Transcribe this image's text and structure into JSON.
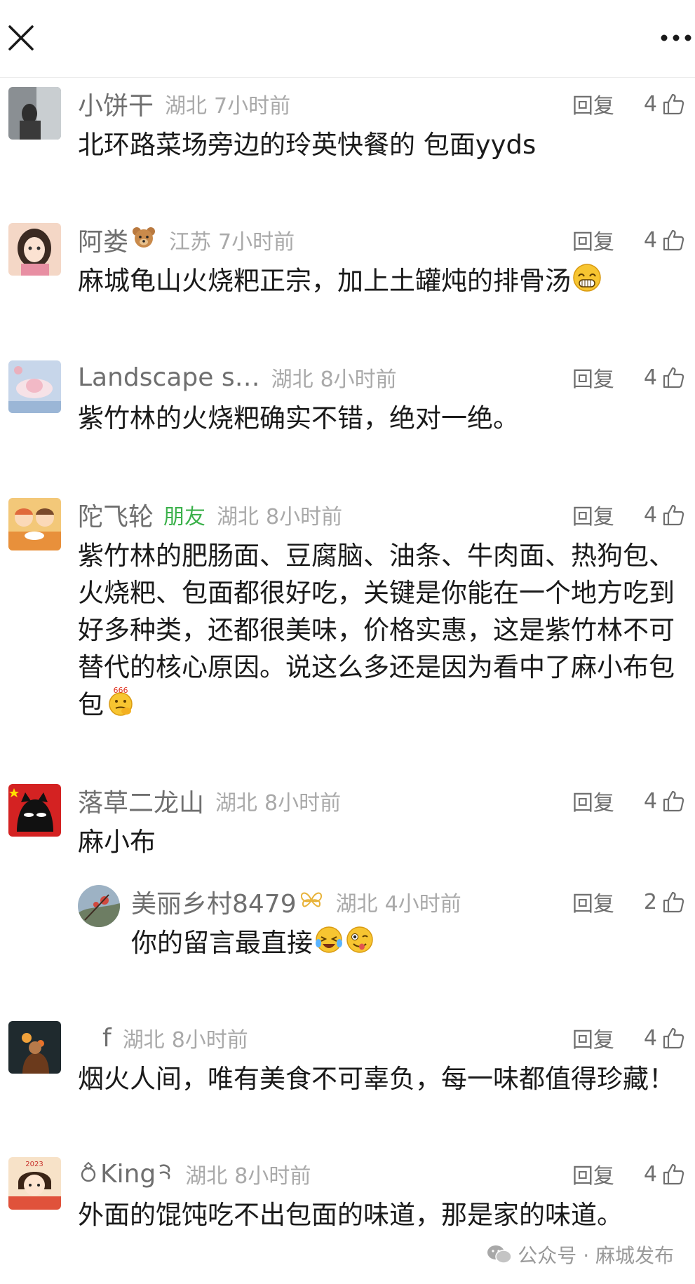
{
  "topbar": {
    "close_icon": "close-icon",
    "more_icon": "more-dots-icon"
  },
  "comments": [
    {
      "name": "小饼干",
      "location": "湖北",
      "time": "7小时前",
      "reply": "回复",
      "likes": "4",
      "text": "北环路菜场旁边的玲英快餐的 包面yyds"
    },
    {
      "name": "阿娄",
      "name_emoji": "teddy-bear-icon",
      "location": "江苏",
      "time": "7小时前",
      "reply": "回复",
      "likes": "4",
      "text": "麻城龟山火烧粑正宗，加上土罐炖的排骨汤",
      "text_emoji": "grin-emoji"
    },
    {
      "name": "Landscape s…",
      "location": "湖北",
      "time": "8小时前",
      "reply": "回复",
      "likes": "4",
      "text": "紫竹林的火烧粑确实不错，绝对一绝。"
    },
    {
      "name": "陀飞轮",
      "tag": "朋友",
      "location": "湖北",
      "time": "8小时前",
      "reply": "回复",
      "likes": "4",
      "text": "紫竹林的肥肠面、豆腐脑、油条、牛肉面、热狗包、火烧粑、包面都很好吃，关键是你能在一个地方吃到好多种类，还都很美味，价格实惠，这是紫竹林不可替代的核心原因。说这么多还是因为看中了麻小布包包",
      "text_emoji": "666-thinking-emoji"
    },
    {
      "name": "落草二龙山",
      "location": "湖北",
      "time": "8小时前",
      "reply": "回复",
      "likes": "4",
      "text": "麻小布"
    },
    {
      "name": "美丽乡村8479",
      "name_emoji": "butterfly-icon",
      "location": "湖北",
      "time": "4小时前",
      "reply": "回复",
      "likes": "2",
      "text": "你的留言最直接",
      "text_emoji": "laugh-cry-wink-emoji"
    },
    {
      "name": "f",
      "location": "湖北",
      "time": "8小时前",
      "reply": "回复",
      "likes": "4",
      "text": "烟火人间，唯有美食不可辜负，每一味都值得珍藏！"
    },
    {
      "name": "King",
      "name_prefix_emoji": "ring-icon",
      "name_suffix_emoji": "cat-ear-icon",
      "location": "湖北",
      "time": "8小时前",
      "reply": "回复",
      "likes": "4",
      "text": "外面的馄饨吃不出包面的味道，那是家的味道。"
    }
  ],
  "watermark": {
    "label": "公众号 · 麻城发布",
    "icon": "wechat-icon"
  },
  "colors": {
    "meta": "#a9a9a9",
    "name": "#6f6f6f",
    "friend": "#3bb14b",
    "text": "#1a1a1a"
  }
}
